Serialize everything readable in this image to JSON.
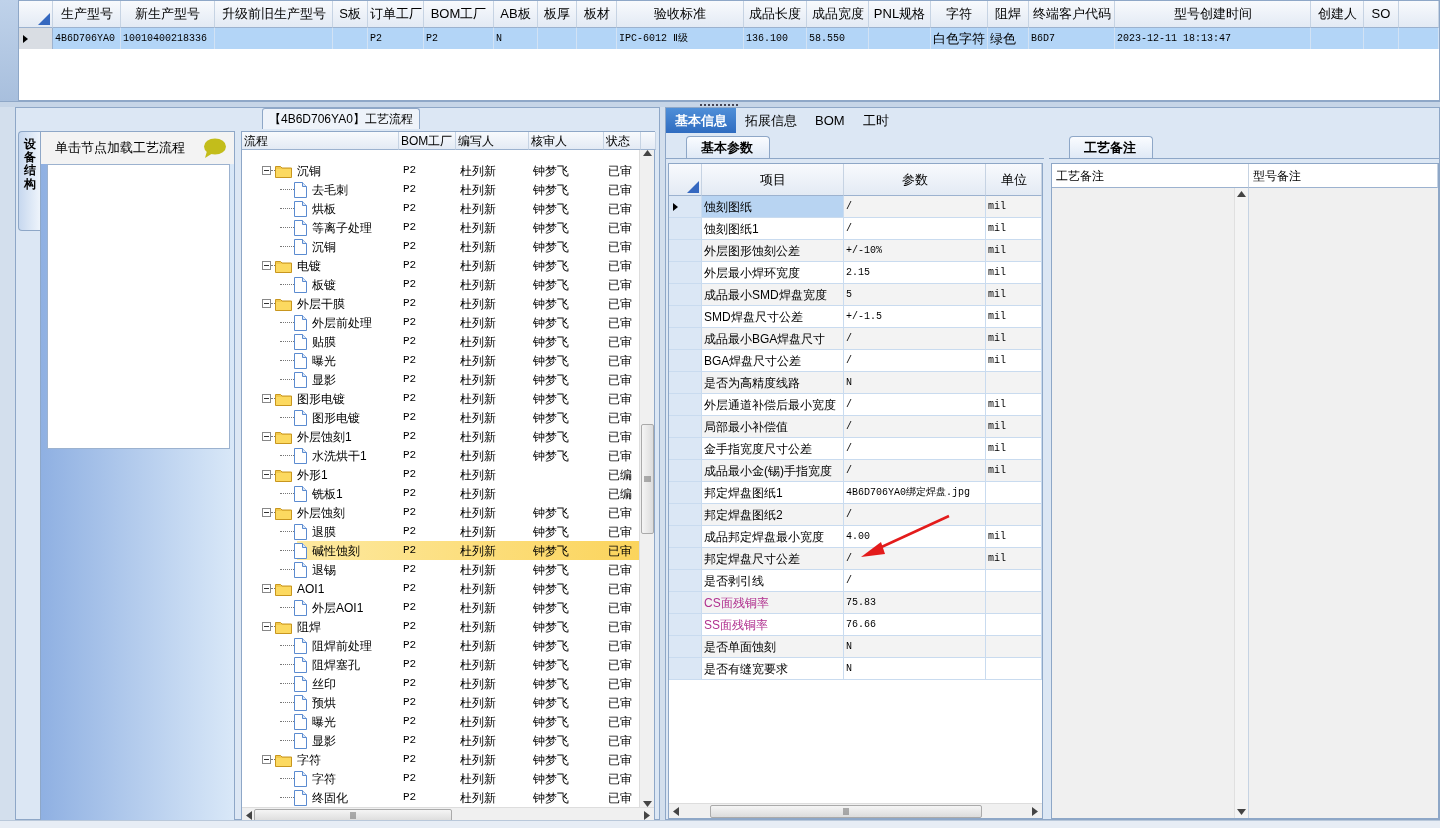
{
  "model_grid": {
    "row_selected": true,
    "columns": [
      {
        "label": "生产型号",
        "value": "4B6D706YA0"
      },
      {
        "label": "新生产型号",
        "value": "10010400218336"
      },
      {
        "label": "升级前旧生产型号"
      },
      {
        "label": "S板"
      },
      {
        "label": "订单工厂",
        "value": "P2"
      },
      {
        "label": "BOM工厂",
        "value": "P2"
      },
      {
        "label": "AB板",
        "value": "N"
      },
      {
        "label": "板厚"
      },
      {
        "label": "板材"
      },
      {
        "label": "验收标准",
        "value": "IPC-6012 Ⅱ级"
      },
      {
        "label": "成品长度",
        "value": "136.100"
      },
      {
        "label": "成品宽度",
        "value": "58.550"
      },
      {
        "label": "PNL规格"
      },
      {
        "label": "字符",
        "value": "白色字符"
      },
      {
        "label": "阻焊",
        "value": "绿色"
      },
      {
        "label": "终端客户代码",
        "value": "B6D7"
      },
      {
        "label": "型号创建时间",
        "value": "2023-12-11 18:13:47"
      },
      {
        "label": "创建人"
      },
      {
        "label": "SO"
      }
    ]
  },
  "process_panel": {
    "title": "【4B6D706YA0】工艺流程",
    "side_tab": "设备结构",
    "hint": "单击节点加载工艺流程",
    "tree_columns": [
      "流程",
      "BOM工厂",
      "编写人",
      "核审人",
      "状态"
    ],
    "tree": [
      {
        "label": "沉铜",
        "bom": "P2",
        "writer": "杜列新",
        "reviewer": "钟梦飞",
        "status": "已审",
        "expanded": true,
        "selected": false,
        "children": [
          {
            "label": "去毛刺",
            "bom": "P2",
            "writer": "杜列新",
            "reviewer": "钟梦飞",
            "status": "已审",
            "selected": false
          },
          {
            "label": "烘板",
            "bom": "P2",
            "writer": "杜列新",
            "reviewer": "钟梦飞",
            "status": "已审",
            "selected": false
          },
          {
            "label": "等离子处理",
            "bom": "P2",
            "writer": "杜列新",
            "reviewer": "钟梦飞",
            "status": "已审",
            "selected": false
          },
          {
            "label": "沉铜",
            "bom": "P2",
            "writer": "杜列新",
            "reviewer": "钟梦飞",
            "status": "已审",
            "selected": false
          }
        ]
      },
      {
        "label": "电镀",
        "bom": "P2",
        "writer": "杜列新",
        "reviewer": "钟梦飞",
        "status": "已审",
        "expanded": true,
        "selected": false,
        "children": [
          {
            "label": "板镀",
            "bom": "P2",
            "writer": "杜列新",
            "reviewer": "钟梦飞",
            "status": "已审",
            "selected": false
          }
        ]
      },
      {
        "label": "外层干膜",
        "bom": "P2",
        "writer": "杜列新",
        "reviewer": "钟梦飞",
        "status": "已审",
        "expanded": true,
        "selected": false,
        "children": [
          {
            "label": "外层前处理",
            "bom": "P2",
            "writer": "杜列新",
            "reviewer": "钟梦飞",
            "status": "已审",
            "selected": false
          },
          {
            "label": "贴膜",
            "bom": "P2",
            "writer": "杜列新",
            "reviewer": "钟梦飞",
            "status": "已审",
            "selected": false
          },
          {
            "label": "曝光",
            "bom": "P2",
            "writer": "杜列新",
            "reviewer": "钟梦飞",
            "status": "已审",
            "selected": false
          },
          {
            "label": "显影",
            "bom": "P2",
            "writer": "杜列新",
            "reviewer": "钟梦飞",
            "status": "已审",
            "selected": false
          }
        ]
      },
      {
        "label": "图形电镀",
        "bom": "P2",
        "writer": "杜列新",
        "reviewer": "钟梦飞",
        "status": "已审",
        "expanded": true,
        "selected": false,
        "children": [
          {
            "label": "图形电镀",
            "bom": "P2",
            "writer": "杜列新",
            "reviewer": "钟梦飞",
            "status": "已审",
            "selected": false
          }
        ]
      },
      {
        "label": "外层蚀刻1",
        "bom": "P2",
        "writer": "杜列新",
        "reviewer": "钟梦飞",
        "status": "已审",
        "expanded": true,
        "selected": false,
        "children": [
          {
            "label": "水洗烘干1",
            "bom": "P2",
            "writer": "杜列新",
            "reviewer": "钟梦飞",
            "status": "已审",
            "selected": false
          }
        ]
      },
      {
        "label": "外形1",
        "bom": "P2",
        "writer": "杜列新",
        "status": "已编",
        "expanded": true,
        "selected": false,
        "children": [
          {
            "label": "铣板1",
            "bom": "P2",
            "writer": "杜列新",
            "status": "已编",
            "selected": false
          }
        ]
      },
      {
        "label": "外层蚀刻",
        "bom": "P2",
        "writer": "杜列新",
        "reviewer": "钟梦飞",
        "status": "已审",
        "expanded": true,
        "selected": false,
        "children": [
          {
            "label": "退膜",
            "bom": "P2",
            "writer": "杜列新",
            "reviewer": "钟梦飞",
            "status": "已审",
            "selected": false
          },
          {
            "label": "碱性蚀刻",
            "bom": "P2",
            "writer": "杜列新",
            "reviewer": "钟梦飞",
            "status": "已审",
            "selected": true
          },
          {
            "label": "退锡",
            "bom": "P2",
            "writer": "杜列新",
            "reviewer": "钟梦飞",
            "status": "已审",
            "selected": false
          }
        ]
      },
      {
        "label": "AOI1",
        "bom": "P2",
        "writer": "杜列新",
        "reviewer": "钟梦飞",
        "status": "已审",
        "expanded": true,
        "selected": false,
        "children": [
          {
            "label": "外层AOI1",
            "bom": "P2",
            "writer": "杜列新",
            "reviewer": "钟梦飞",
            "status": "已审",
            "selected": false
          }
        ]
      },
      {
        "label": "阻焊",
        "bom": "P2",
        "writer": "杜列新",
        "reviewer": "钟梦飞",
        "status": "已审",
        "expanded": true,
        "selected": false,
        "children": [
          {
            "label": "阻焊前处理",
            "bom": "P2",
            "writer": "杜列新",
            "reviewer": "钟梦飞",
            "status": "已审",
            "selected": false
          },
          {
            "label": "阻焊塞孔",
            "bom": "P2",
            "writer": "杜列新",
            "reviewer": "钟梦飞",
            "status": "已审",
            "selected": false
          },
          {
            "label": "丝印",
            "bom": "P2",
            "writer": "杜列新",
            "reviewer": "钟梦飞",
            "status": "已审",
            "selected": false
          },
          {
            "label": "预烘",
            "bom": "P2",
            "writer": "杜列新",
            "reviewer": "钟梦飞",
            "status": "已审",
            "selected": false
          },
          {
            "label": "曝光",
            "bom": "P2",
            "writer": "杜列新",
            "reviewer": "钟梦飞",
            "status": "已审",
            "selected": false
          },
          {
            "label": "显影",
            "bom": "P2",
            "writer": "杜列新",
            "reviewer": "钟梦飞",
            "status": "已审",
            "selected": false
          }
        ]
      },
      {
        "label": "字符",
        "bom": "P2",
        "writer": "杜列新",
        "reviewer": "钟梦飞",
        "status": "已审",
        "expanded": true,
        "selected": false,
        "children": [
          {
            "label": "字符",
            "bom": "P2",
            "writer": "杜列新",
            "reviewer": "钟梦飞",
            "status": "已审",
            "selected": false
          },
          {
            "label": "终固化",
            "bom": "P2",
            "writer": "杜列新",
            "reviewer": "钟梦飞",
            "status": "已审",
            "selected": false
          }
        ]
      }
    ]
  },
  "detail_panel": {
    "tabs": [
      {
        "label": "基本信息",
        "selected": true
      },
      {
        "label": "拓展信息",
        "selected": false
      },
      {
        "label": "BOM",
        "selected": false
      },
      {
        "label": "工时",
        "selected": false
      }
    ],
    "params": {
      "tab": "基本参数",
      "columns": [
        "项目",
        "参数",
        "单位"
      ],
      "rows": [
        {
          "item": "蚀刻图纸",
          "value": "/",
          "unit": "mil",
          "selected": true
        },
        {
          "item": "蚀刻图纸1",
          "value": "/",
          "unit": "mil",
          "selected": false
        },
        {
          "item": "外层图形蚀刻公差",
          "value": "+/-10%",
          "unit": "mil",
          "selected": false
        },
        {
          "item": "外层最小焊环宽度",
          "value": "2.15",
          "unit": "mil",
          "selected": false
        },
        {
          "item": "成品最小SMD焊盘宽度",
          "value": "5",
          "unit": "mil",
          "selected": false
        },
        {
          "item": "SMD焊盘尺寸公差",
          "value": "+/-1.5",
          "unit": "mil",
          "selected": false
        },
        {
          "item": "成品最小BGA焊盘尺寸",
          "value": "/",
          "unit": "mil",
          "selected": false
        },
        {
          "item": "BGA焊盘尺寸公差",
          "value": "/",
          "unit": "mil",
          "selected": false
        },
        {
          "item": "是否为高精度线路",
          "value": "N",
          "selected": false
        },
        {
          "item": "外层通道补偿后最小宽度",
          "value": "/",
          "unit": "mil",
          "selected": false
        },
        {
          "item": "局部最小补偿值",
          "value": "/",
          "unit": "mil",
          "selected": false
        },
        {
          "item": "金手指宽度尺寸公差",
          "value": "/",
          "unit": "mil",
          "selected": false
        },
        {
          "item": "成品最小金(锡)手指宽度",
          "value": "/",
          "unit": "mil",
          "selected": false
        },
        {
          "item": "邦定焊盘图纸1",
          "value": "4B6D706YA0绑定焊盘.jpg",
          "selected": false
        },
        {
          "item": "邦定焊盘图纸2",
          "value": "/",
          "selected": false
        },
        {
          "item": "成品邦定焊盘最小宽度",
          "value": "4.00",
          "unit": "mil",
          "selected": false
        },
        {
          "item": "邦定焊盘尺寸公差",
          "value": "/",
          "unit": "mil",
          "selected": false
        },
        {
          "item": "是否剥引线",
          "value": "/",
          "selected": false
        },
        {
          "item": "CS面残铜率",
          "value": "75.83",
          "selected": false,
          "color": "#b0308f"
        },
        {
          "item": "SS面残铜率",
          "value": "76.66",
          "selected": false,
          "color": "#b0308f"
        },
        {
          "item": "是否单面蚀刻",
          "value": "N",
          "selected": false
        },
        {
          "item": "是否有缝宽要求",
          "value": "N",
          "selected": false
        }
      ]
    },
    "notes": {
      "tab": "工艺备注",
      "columns": [
        "工艺备注",
        "型号备注"
      ]
    }
  }
}
